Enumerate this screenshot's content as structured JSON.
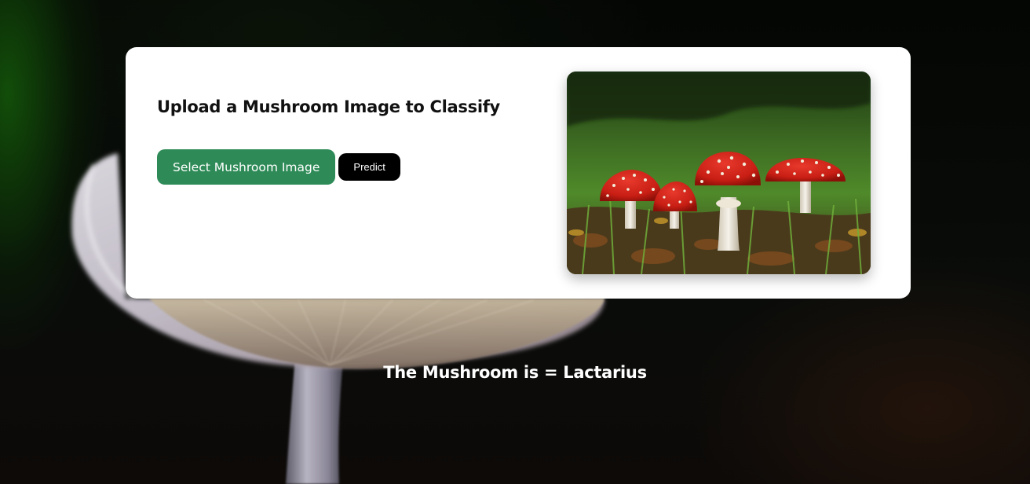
{
  "card": {
    "title": "Upload a Mushroom Image to Classify",
    "select_button_label": "Select Mushroom Image",
    "predict_button_label": "Predict",
    "preview_image_subject": "red-fly-agaric-mushrooms-in-grass"
  },
  "result": {
    "text": "The Mushroom is = Lactarius"
  },
  "colors": {
    "select_button": "#2e8b57",
    "predict_button": "#000000",
    "card_background": "#ffffff",
    "page_background": "#050a05",
    "result_text": "#ffffff"
  },
  "background_image_subject": "pale-mushroom-cap-close-up"
}
